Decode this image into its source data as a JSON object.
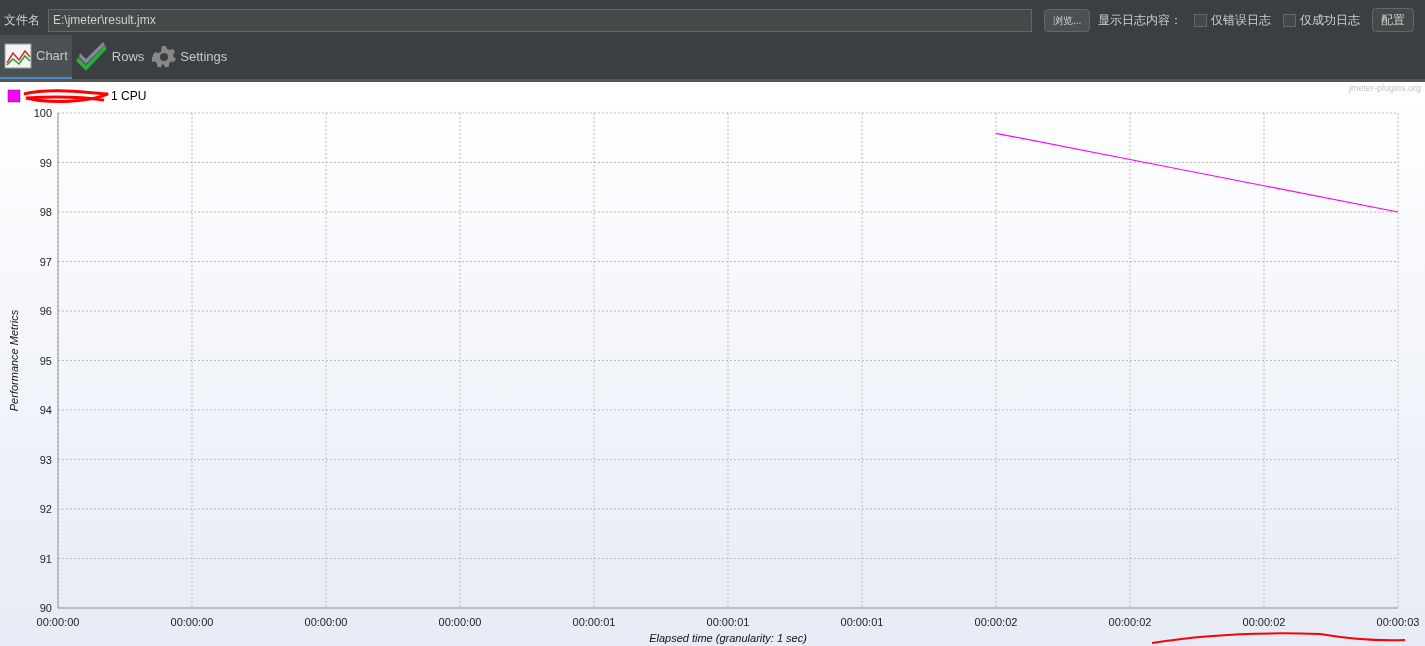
{
  "file_row": {
    "label": "文件名",
    "value": "E:\\jmeter\\result.jmx",
    "browse": "浏览...",
    "log_label": "显示日志内容：",
    "checkboxes": [
      {
        "label": "仅错误日志",
        "checked": false
      },
      {
        "label": "仅成功日志",
        "checked": false
      }
    ],
    "config": "配置"
  },
  "tabs": [
    {
      "label": "Chart",
      "kind": "chart",
      "selected": true
    },
    {
      "label": "Rows",
      "kind": "rows",
      "selected": false
    },
    {
      "label": "Settings",
      "kind": "settings",
      "selected": false
    }
  ],
  "chart": {
    "credit": "jmeter-plugins.org",
    "chart_data": {
      "type": "line",
      "xlabel": "Elapsed time (granularity: 1 sec)",
      "ylabel": "Performance Metrics",
      "categories": [
        "00:00:00",
        "00:00:00",
        "00:00:00",
        "00:00:00",
        "00:00:01",
        "00:00:01",
        "00:00:01",
        "00:00:02",
        "00:00:02",
        "00:00:02",
        "00:00:03"
      ],
      "series": [
        {
          "name": "1 CPU",
          "color": "#ff00ff",
          "values": [
            null,
            null,
            null,
            null,
            null,
            null,
            null,
            99.59,
            99.06,
            98.53,
            98.0
          ]
        }
      ],
      "ylim": [
        90,
        100
      ],
      "grid": true,
      "yticks": [
        90,
        91,
        92,
        93,
        94,
        95,
        96,
        97,
        98,
        99,
        100
      ]
    }
  }
}
